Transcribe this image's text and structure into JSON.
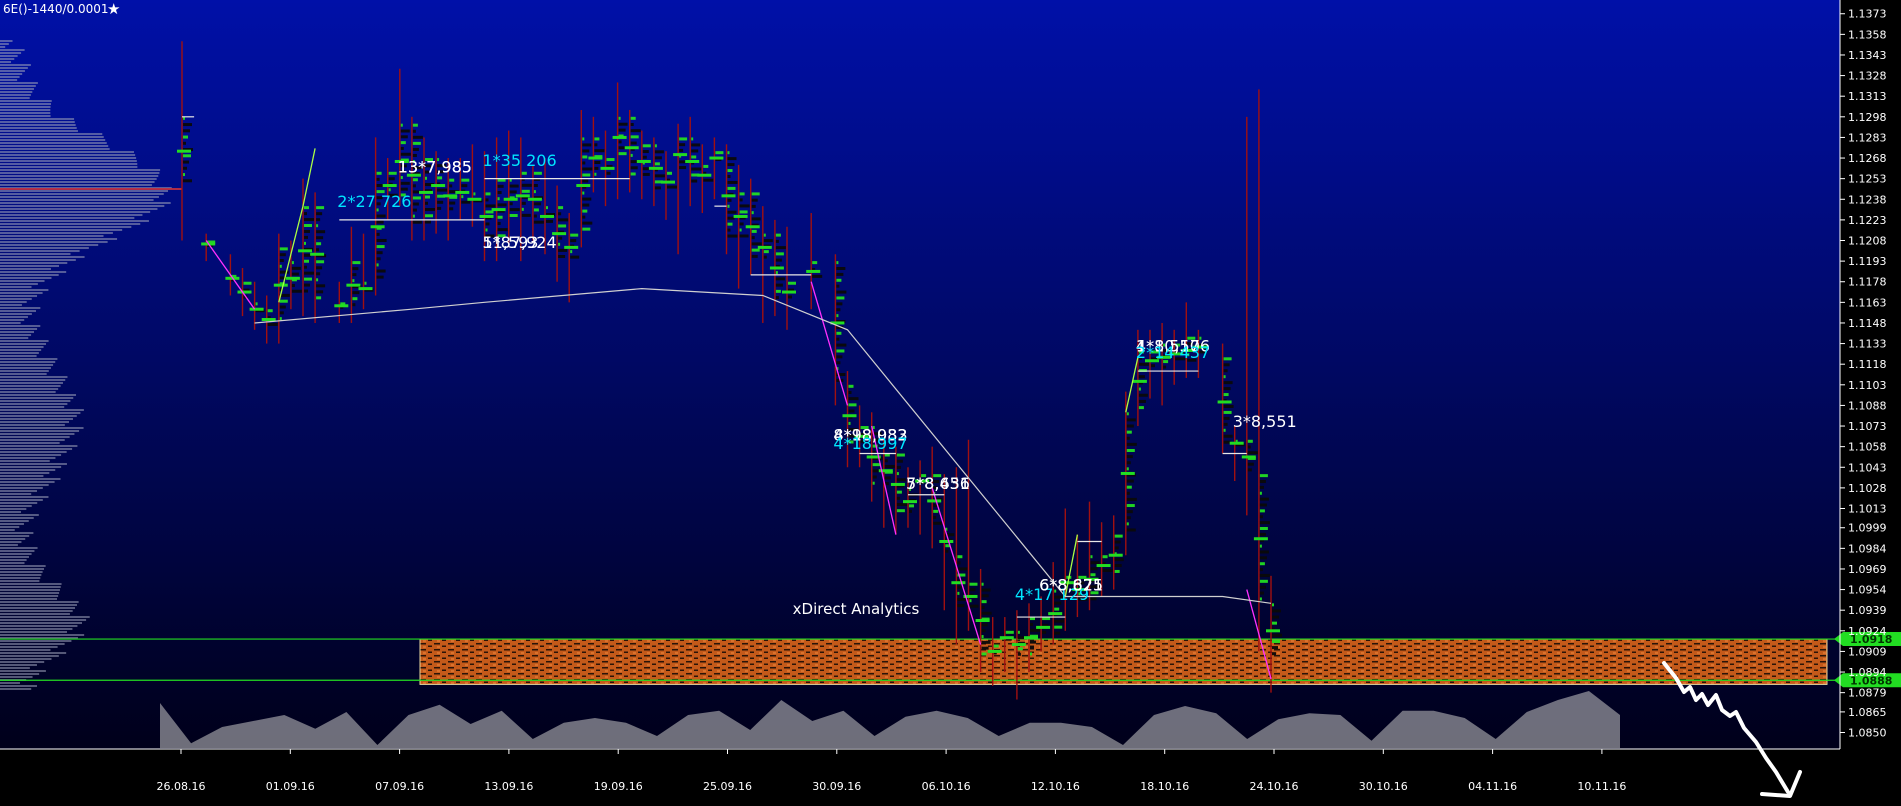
{
  "header": {
    "symbol": "6E()-1440/0.0001"
  },
  "watermark": "xDirect Analytics",
  "colors": {
    "bg_top": "#0010a8",
    "bg_bottom": "#00001a",
    "bull": "#22dd22",
    "wick": "#a01010",
    "cyan": "#00e5ff",
    "white": "#ffffff",
    "magenta": "#ff30ff",
    "lime": "#aaff44",
    "orange": "#e06a20",
    "price_line": "#22dd22"
  },
  "chart_data": {
    "type": "candlestick",
    "title": "",
    "ylim": [
      1.0838,
      1.1383
    ],
    "y_ticks": [
      "1.1373",
      "1.1358",
      "1.1343",
      "1.1328",
      "1.1313",
      "1.1298",
      "1.1283",
      "1.1268",
      "1.1253",
      "1.1238",
      "1.1223",
      "1.1208",
      "1.1193",
      "1.1178",
      "1.1163",
      "1.1148",
      "1.1133",
      "1.1118",
      "1.1103",
      "1.1088",
      "1.1073",
      "1.1058",
      "1.1043",
      "1.1028",
      "1.1013",
      "1.0999",
      "1.0984",
      "1.0969",
      "1.0954",
      "1.0939",
      "1.0924",
      "1.0909",
      "1.0894",
      "1.0879",
      "1.0865",
      "1.0850"
    ],
    "x_labels": [
      "26.08.16",
      "01.09.16",
      "07.09.16",
      "13.09.16",
      "19.09.16",
      "25.09.16",
      "30.09.16",
      "06.10.16",
      "12.10.16",
      "18.10.16",
      "24.10.16",
      "30.10.16",
      "04.11.16",
      "10.11.16"
    ],
    "price_levels": {
      "upper": {
        "label": "1.0918",
        "value": 1.0918
      },
      "lower": {
        "label": "1.0888",
        "value": 1.0888
      }
    },
    "zone": {
      "from": 1.0885,
      "to": 1.0918
    },
    "candles": [
      {
        "d": 0,
        "o": 1.1298,
        "h": 1.1353,
        "l": 1.1208,
        "c": 1.1248
      },
      {
        "d": 2,
        "o": 1.1203,
        "h": 1.1213,
        "l": 1.1193,
        "c": 1.1208
      },
      {
        "d": 4,
        "o": 1.1183,
        "h": 1.1198,
        "l": 1.1168,
        "c": 1.1178
      },
      {
        "d": 5,
        "o": 1.1178,
        "h": 1.1188,
        "l": 1.1153,
        "c": 1.1163
      },
      {
        "d": 6,
        "o": 1.1163,
        "h": 1.1178,
        "l": 1.1143,
        "c": 1.1153
      },
      {
        "d": 7,
        "o": 1.1158,
        "h": 1.1168,
        "l": 1.1133,
        "c": 1.1143
      },
      {
        "d": 8,
        "o": 1.1148,
        "h": 1.1213,
        "l": 1.1133,
        "c": 1.1203
      },
      {
        "d": 9,
        "o": 1.1193,
        "h": 1.1208,
        "l": 1.1158,
        "c": 1.1168
      },
      {
        "d": 10,
        "o": 1.1168,
        "h": 1.1253,
        "l": 1.1153,
        "c": 1.1233
      },
      {
        "d": 11,
        "o": 1.1233,
        "h": 1.1243,
        "l": 1.1148,
        "c": 1.1163
      },
      {
        "d": 13,
        "o": 1.1163,
        "h": 1.1178,
        "l": 1.1148,
        "c": 1.1158
      },
      {
        "d": 14,
        "o": 1.1158,
        "h": 1.1218,
        "l": 1.1148,
        "c": 1.1193
      },
      {
        "d": 15,
        "o": 1.1168,
        "h": 1.1213,
        "l": 1.1158,
        "c": 1.1178
      },
      {
        "d": 16,
        "o": 1.1178,
        "h": 1.1283,
        "l": 1.1168,
        "c": 1.1258
      },
      {
        "d": 17,
        "o": 1.1258,
        "h": 1.1268,
        "l": 1.1223,
        "c": 1.1238
      },
      {
        "d": 18,
        "o": 1.1238,
        "h": 1.1333,
        "l": 1.1233,
        "c": 1.1293
      },
      {
        "d": 19,
        "o": 1.1293,
        "h": 1.1298,
        "l": 1.1208,
        "c": 1.1218
      },
      {
        "d": 20,
        "o": 1.1218,
        "h": 1.1283,
        "l": 1.1208,
        "c": 1.1268
      },
      {
        "d": 21,
        "o": 1.1268,
        "h": 1.1273,
        "l": 1.1213,
        "c": 1.1228
      },
      {
        "d": 22,
        "o": 1.1228,
        "h": 1.1268,
        "l": 1.1208,
        "c": 1.1253
      },
      {
        "d": 23,
        "o": 1.1253,
        "h": 1.1268,
        "l": 1.1223,
        "c": 1.1233
      },
      {
        "d": 24,
        "o": 1.1233,
        "h": 1.1278,
        "l": 1.1218,
        "c": 1.1243
      },
      {
        "d": 25,
        "o": 1.1243,
        "h": 1.1273,
        "l": 1.1193,
        "c": 1.1208
      },
      {
        "d": 26,
        "o": 1.1208,
        "h": 1.1283,
        "l": 1.1193,
        "c": 1.1253
      },
      {
        "d": 27,
        "o": 1.1253,
        "h": 1.1288,
        "l": 1.1203,
        "c": 1.1223
      },
      {
        "d": 28,
        "o": 1.1223,
        "h": 1.1283,
        "l": 1.1193,
        "c": 1.1258
      },
      {
        "d": 29,
        "o": 1.1258,
        "h": 1.1263,
        "l": 1.1208,
        "c": 1.1218
      },
      {
        "d": 30,
        "o": 1.1218,
        "h": 1.1268,
        "l": 1.1198,
        "c": 1.1233
      },
      {
        "d": 31,
        "o": 1.1233,
        "h": 1.1248,
        "l": 1.1178,
        "c": 1.1193
      },
      {
        "d": 32,
        "o": 1.1193,
        "h": 1.1228,
        "l": 1.1163,
        "c": 1.1213
      },
      {
        "d": 33,
        "o": 1.1213,
        "h": 1.1303,
        "l": 1.1203,
        "c": 1.1283
      },
      {
        "d": 34,
        "o": 1.1283,
        "h": 1.1298,
        "l": 1.1243,
        "c": 1.1253
      },
      {
        "d": 35,
        "o": 1.1253,
        "h": 1.1288,
        "l": 1.1233,
        "c": 1.1268
      },
      {
        "d": 36,
        "o": 1.1268,
        "h": 1.1323,
        "l": 1.1238,
        "c": 1.1298
      },
      {
        "d": 37,
        "o": 1.1298,
        "h": 1.1303,
        "l": 1.1243,
        "c": 1.1253
      },
      {
        "d": 38,
        "o": 1.1253,
        "h": 1.1288,
        "l": 1.1238,
        "c": 1.1278
      },
      {
        "d": 39,
        "o": 1.1278,
        "h": 1.1283,
        "l": 1.1233,
        "c": 1.1243
      },
      {
        "d": 40,
        "o": 1.1243,
        "h": 1.1273,
        "l": 1.1223,
        "c": 1.1258
      },
      {
        "d": 41,
        "o": 1.1258,
        "h": 1.1293,
        "l": 1.1198,
        "c": 1.1283
      },
      {
        "d": 42,
        "o": 1.1283,
        "h": 1.1298,
        "l": 1.1233,
        "c": 1.1248
      },
      {
        "d": 43,
        "o": 1.1248,
        "h": 1.1278,
        "l": 1.1228,
        "c": 1.1263
      },
      {
        "d": 44,
        "o": 1.1263,
        "h": 1.1283,
        "l": 1.1238,
        "c": 1.1273
      },
      {
        "d": 45,
        "o": 1.1273,
        "h": 1.1278,
        "l": 1.1198,
        "c": 1.1208
      },
      {
        "d": 46,
        "o": 1.1208,
        "h": 1.1263,
        "l": 1.1173,
        "c": 1.1243
      },
      {
        "d": 47,
        "o": 1.1243,
        "h": 1.1253,
        "l": 1.1183,
        "c": 1.1193
      },
      {
        "d": 48,
        "o": 1.1193,
        "h": 1.1233,
        "l": 1.1148,
        "c": 1.1213
      },
      {
        "d": 49,
        "o": 1.1213,
        "h": 1.1223,
        "l": 1.1153,
        "c": 1.1163
      },
      {
        "d": 50,
        "o": 1.1163,
        "h": 1.1218,
        "l": 1.1143,
        "c": 1.1178
      },
      {
        "d": 52,
        "o": 1.1178,
        "h": 1.1228,
        "l": 1.1158,
        "c": 1.1193
      },
      {
        "d": 54,
        "o": 1.1193,
        "h": 1.1198,
        "l": 1.1088,
        "c": 1.1103
      },
      {
        "d": 55,
        "o": 1.1103,
        "h": 1.1113,
        "l": 1.1043,
        "c": 1.1058
      },
      {
        "d": 56,
        "o": 1.1058,
        "h": 1.1088,
        "l": 1.1043,
        "c": 1.1073
      },
      {
        "d": 57,
        "o": 1.1073,
        "h": 1.1083,
        "l": 1.1018,
        "c": 1.1028
      },
      {
        "d": 58,
        "o": 1.1028,
        "h": 1.1063,
        "l": 1.0999,
        "c": 1.1053
      },
      {
        "d": 59,
        "o": 1.1053,
        "h": 1.1058,
        "l": 1.0994,
        "c": 1.1008
      },
      {
        "d": 60,
        "o": 1.1008,
        "h": 1.1043,
        "l": 1.0999,
        "c": 1.1028
      },
      {
        "d": 61,
        "o": 1.1028,
        "h": 1.1048,
        "l": 1.0994,
        "c": 1.1038
      },
      {
        "d": 62,
        "o": 1.1038,
        "h": 1.1058,
        "l": 1.0984,
        "c": 1.0999
      },
      {
        "d": 63,
        "o": 1.0999,
        "h": 1.1038,
        "l": 1.0939,
        "c": 1.0979
      },
      {
        "d": 64,
        "o": 1.0979,
        "h": 1.1043,
        "l": 1.0914,
        "c": 1.0939
      },
      {
        "d": 65,
        "o": 1.0939,
        "h": 1.1063,
        "l": 1.0924,
        "c": 1.0959
      },
      {
        "d": 66,
        "o": 1.0959,
        "h": 1.0969,
        "l": 1.0894,
        "c": 1.0904
      },
      {
        "d": 67,
        "o": 1.0904,
        "h": 1.0934,
        "l": 1.0884,
        "c": 1.0914
      },
      {
        "d": 68,
        "o": 1.0914,
        "h": 1.0934,
        "l": 1.0894,
        "c": 1.0924
      },
      {
        "d": 69,
        "o": 1.0924,
        "h": 1.0939,
        "l": 1.0874,
        "c": 1.0904
      },
      {
        "d": 70,
        "o": 1.0904,
        "h": 1.0944,
        "l": 1.0894,
        "c": 1.0934
      },
      {
        "d": 71,
        "o": 1.0934,
        "h": 1.0949,
        "l": 1.0909,
        "c": 1.0919
      },
      {
        "d": 72,
        "o": 1.0919,
        "h": 1.0974,
        "l": 1.0914,
        "c": 1.0954
      },
      {
        "d": 73,
        "o": 1.0954,
        "h": 1.1013,
        "l": 1.0924,
        "c": 1.0964
      },
      {
        "d": 74,
        "o": 1.0964,
        "h": 1.0994,
        "l": 1.0934,
        "c": 1.0944
      },
      {
        "d": 75,
        "o": 1.0944,
        "h": 1.1018,
        "l": 1.0939,
        "c": 1.0979
      },
      {
        "d": 76,
        "o": 1.0979,
        "h": 1.1003,
        "l": 1.0949,
        "c": 1.0964
      },
      {
        "d": 77,
        "o": 1.0964,
        "h": 1.1008,
        "l": 1.0954,
        "c": 1.0994
      },
      {
        "d": 78,
        "o": 1.0994,
        "h": 1.1098,
        "l": 1.0979,
        "c": 1.1083
      },
      {
        "d": 79,
        "o": 1.1083,
        "h": 1.1143,
        "l": 1.1073,
        "c": 1.1128
      },
      {
        "d": 80,
        "o": 1.1128,
        "h": 1.1143,
        "l": 1.1093,
        "c": 1.1113
      },
      {
        "d": 81,
        "o": 1.1113,
        "h": 1.1148,
        "l": 1.1088,
        "c": 1.1133
      },
      {
        "d": 82,
        "o": 1.1133,
        "h": 1.1143,
        "l": 1.1103,
        "c": 1.1118
      },
      {
        "d": 83,
        "o": 1.1118,
        "h": 1.1163,
        "l": 1.1108,
        "c": 1.1138
      },
      {
        "d": 84,
        "o": 1.1138,
        "h": 1.1143,
        "l": 1.1108,
        "c": 1.1123
      },
      {
        "d": 86,
        "o": 1.1123,
        "h": 1.1133,
        "l": 1.1053,
        "c": 1.1058
      },
      {
        "d": 87,
        "o": 1.1058,
        "h": 1.1073,
        "l": 1.1033,
        "c": 1.1063
      },
      {
        "d": 88,
        "o": 1.1063,
        "h": 1.1298,
        "l": 1.1008,
        "c": 1.1038
      },
      {
        "d": 89,
        "o": 1.1038,
        "h": 1.1318,
        "l": 1.0909,
        "c": 1.0944
      },
      {
        "d": 90,
        "o": 1.0944,
        "h": 1.0964,
        "l": 1.0879,
        "c": 1.0904
      }
    ],
    "trend_lines": [
      {
        "color": "magenta",
        "pts": [
          [
            2,
            1.1208
          ],
          [
            6,
            1.1158
          ]
        ]
      },
      {
        "color": "lime",
        "pts": [
          [
            8,
            1.1163
          ],
          [
            10,
            1.1233
          ],
          [
            11,
            1.1275
          ]
        ]
      },
      {
        "color": "magenta",
        "pts": [
          [
            52,
            1.1178
          ],
          [
            55,
            1.1088
          ]
        ]
      },
      {
        "color": "magenta",
        "pts": [
          [
            57,
            1.1073
          ],
          [
            59,
            1.0994
          ]
        ]
      },
      {
        "color": "magenta",
        "pts": [
          [
            62,
            1.1028
          ],
          [
            66,
            1.0914
          ]
        ]
      },
      {
        "color": "lime",
        "pts": [
          [
            73,
            1.0949
          ],
          [
            74,
            1.0994
          ]
        ]
      },
      {
        "color": "lime",
        "pts": [
          [
            78,
            1.1083
          ],
          [
            79,
            1.1123
          ]
        ]
      },
      {
        "color": "magenta",
        "pts": [
          [
            88,
            1.0954
          ],
          [
            90,
            1.0889
          ]
        ]
      }
    ],
    "white_levels": [
      {
        "from": 0,
        "to": 1,
        "v": 1.1298
      },
      {
        "from": 13,
        "to": 25,
        "v": 1.1223
      },
      {
        "from": 25,
        "to": 37,
        "v": 1.1253
      },
      {
        "from": 44,
        "to": 45,
        "v": 1.1233
      },
      {
        "from": 47,
        "to": 52,
        "v": 1.1183
      },
      {
        "from": 56,
        "to": 59,
        "v": 1.1053
      },
      {
        "from": 60,
        "to": 63,
        "v": 1.1023
      },
      {
        "from": 69,
        "to": 73,
        "v": 1.0934
      },
      {
        "from": 74,
        "to": 76,
        "v": 1.0989
      },
      {
        "from": 79,
        "to": 84,
        "v": 1.1113
      },
      {
        "from": 86,
        "to": 88,
        "v": 1.1053
      }
    ],
    "poc_line": [
      [
        6,
        1.1148
      ],
      [
        19,
        1.1158
      ],
      [
        25,
        1.1163
      ],
      [
        38,
        1.1173
      ],
      [
        48,
        1.1168
      ],
      [
        55,
        1.1143
      ],
      [
        73,
        1.0949
      ],
      [
        86,
        1.0949
      ],
      [
        90,
        1.0944
      ]
    ],
    "annotations": [
      {
        "text": "13*7,985",
        "d": 18,
        "v": 1.1253,
        "color": "white"
      },
      {
        "text": "13*7,985",
        "d": 18,
        "v": 1.1253,
        "color": "white"
      },
      {
        "text": "2*27 726",
        "d": 13,
        "v": 1.1228,
        "color": "cyan"
      },
      {
        "text": "1*35 206",
        "d": 25,
        "v": 1.1258,
        "color": "cyan"
      },
      {
        "text": "5*87,924",
        "d": 25,
        "v": 1.1198,
        "color": "white"
      },
      {
        "text": "11,593",
        "d": 25,
        "v": 1.1198,
        "color": "white"
      },
      {
        "text": "8*18,083",
        "d": 54,
        "v": 1.1058,
        "color": "white"
      },
      {
        "text": "4*98,932",
        "d": 54,
        "v": 1.1058,
        "color": "white"
      },
      {
        "text": "4*18 997",
        "d": 54,
        "v": 1.1052,
        "color": "cyan"
      },
      {
        "text": "7*8,636",
        "d": 60,
        "v": 1.1023,
        "color": "white"
      },
      {
        "text": "5*8,451",
        "d": 60,
        "v": 1.1023,
        "color": "white"
      },
      {
        "text": "4*17 129",
        "d": 69,
        "v": 1.0942,
        "color": "cyan"
      },
      {
        "text": "6*8,825",
        "d": 71,
        "v": 1.0949,
        "color": "white"
      },
      {
        "text": "6*8,671",
        "d": 71,
        "v": 1.0949,
        "color": "white"
      },
      {
        "text": "4*8,550",
        "d": 79,
        "v": 1.1123,
        "color": "white"
      },
      {
        "text": "1*10,176",
        "d": 79,
        "v": 1.1123,
        "color": "white"
      },
      {
        "text": "2*14 437",
        "d": 79,
        "v": 1.1118,
        "color": "cyan"
      },
      {
        "text": "3*8,551",
        "d": 87,
        "v": 1.1068,
        "color": "white"
      }
    ],
    "volume_peaks": [
      0.75,
      0.08,
      0.35,
      0.45,
      0.55,
      0.32,
      0.6,
      0.05,
      0.55,
      0.72,
      0.4,
      0.62,
      0.15,
      0.42,
      0.5,
      0.42,
      0.2,
      0.55,
      0.62,
      0.3,
      0.8,
      0.45,
      0.62,
      0.2,
      0.52,
      0.62,
      0.5,
      0.2,
      0.42,
      0.42,
      0.35,
      0.05,
      0.55,
      0.7,
      0.58,
      0.15,
      0.48,
      0.58,
      0.55,
      0.12,
      0.62,
      0.62,
      0.5,
      0.15,
      0.6,
      0.8,
      0.95,
      0.55
    ]
  }
}
